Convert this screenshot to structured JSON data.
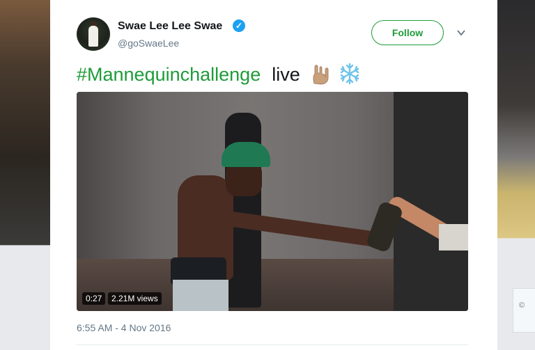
{
  "tweet": {
    "author_name": "Swae Lee Lee Swae",
    "handle": "@goSwaeLee",
    "follow_label": "Follow",
    "hashtag": "#Mannequinchallenge",
    "text": "live",
    "timestamp": "6:55 AM - 4 Nov 2016"
  },
  "video": {
    "duration": "0:27",
    "views": "2.21M views"
  },
  "side_panel_text": "©",
  "icons": [
    "verified-badge-icon",
    "chevron-down-icon",
    "sign-of-horns-emoji",
    "snowflake-emoji"
  ],
  "colors": {
    "follow_accent": "#1f9b3a",
    "hashtag": "#1f9b3a",
    "verified": "#1da1f2",
    "meta_text": "#657786"
  }
}
